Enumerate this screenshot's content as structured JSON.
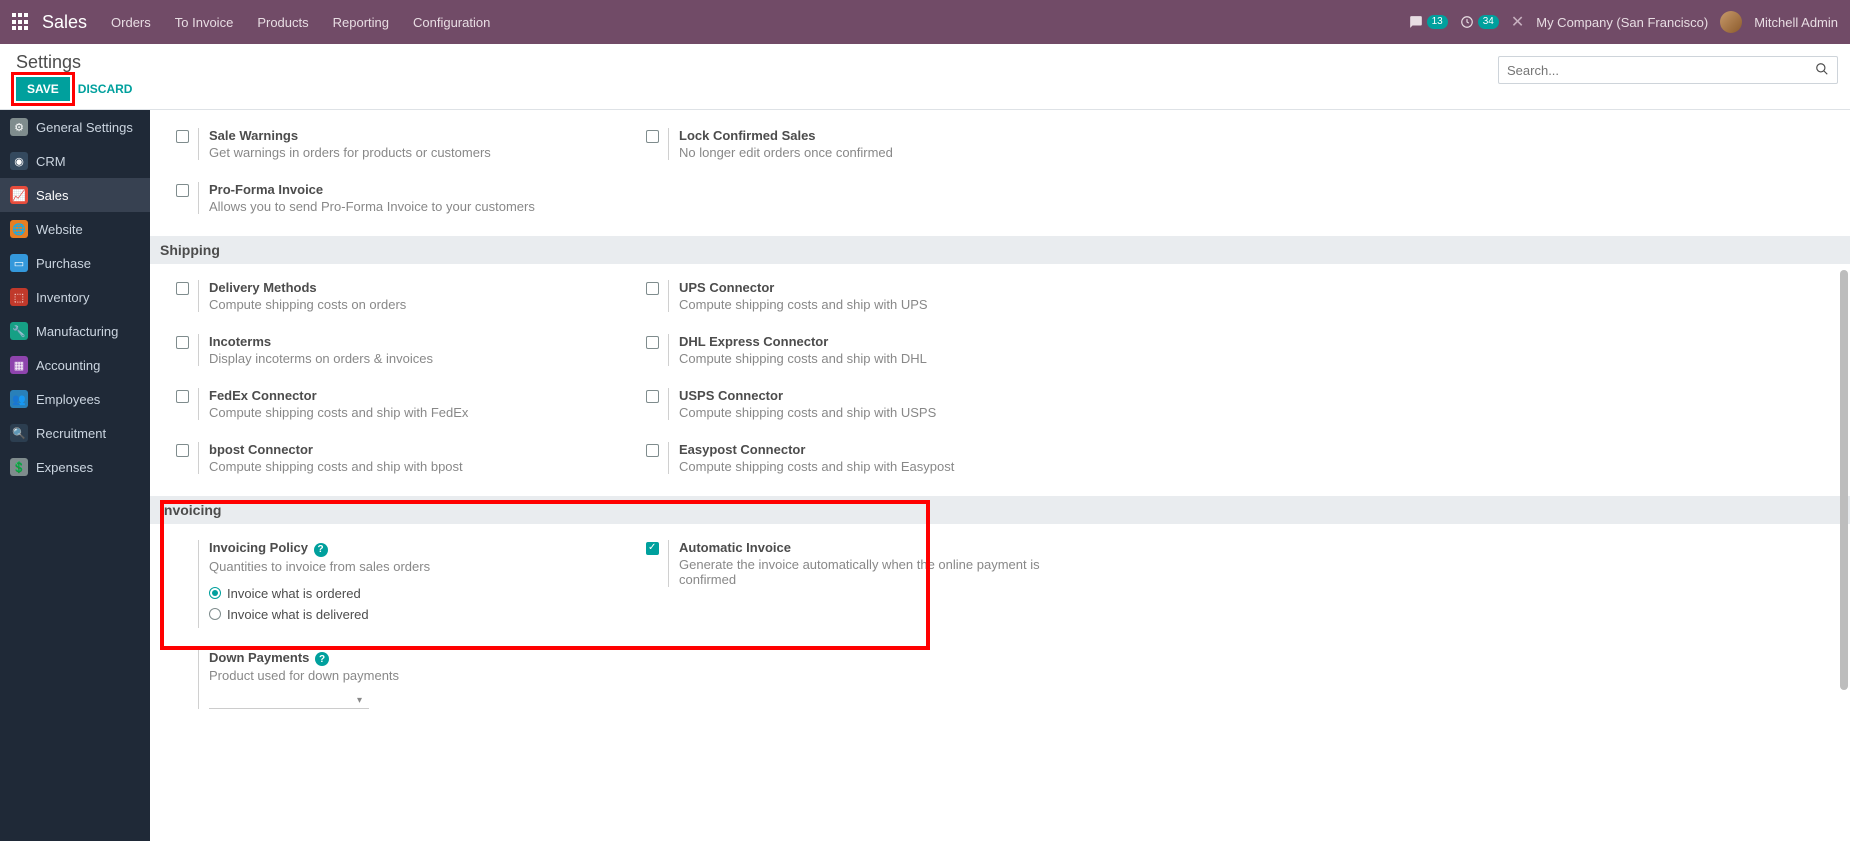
{
  "topbar": {
    "brand": "Sales",
    "menu": [
      "Orders",
      "To Invoice",
      "Products",
      "Reporting",
      "Configuration"
    ],
    "msg_count": "13",
    "activity_count": "34",
    "company": "My Company (San Francisco)",
    "user": "Mitchell Admin"
  },
  "subheader": {
    "title": "Settings",
    "save": "Save",
    "discard": "Discard",
    "search_placeholder": "Search..."
  },
  "sidebar": {
    "items": [
      {
        "label": "General Settings"
      },
      {
        "label": "CRM"
      },
      {
        "label": "Sales"
      },
      {
        "label": "Website"
      },
      {
        "label": "Purchase"
      },
      {
        "label": "Inventory"
      },
      {
        "label": "Manufacturing"
      },
      {
        "label": "Accounting"
      },
      {
        "label": "Employees"
      },
      {
        "label": "Recruitment"
      },
      {
        "label": "Expenses"
      }
    ]
  },
  "sections": {
    "quotes": [
      {
        "title": "Sale Warnings",
        "desc": "Get warnings in orders for products or customers",
        "checked": false
      },
      {
        "title": "Lock Confirmed Sales",
        "desc": "No longer edit orders once confirmed",
        "checked": false
      },
      {
        "title": "Pro-Forma Invoice",
        "desc": "Allows you to send Pro-Forma Invoice to your customers",
        "checked": false
      }
    ],
    "shipping_header": "Shipping",
    "shipping": [
      {
        "title": "Delivery Methods",
        "desc": "Compute shipping costs on orders",
        "checked": false
      },
      {
        "title": "UPS Connector",
        "desc": "Compute shipping costs and ship with UPS",
        "checked": false
      },
      {
        "title": "Incoterms",
        "desc": "Display incoterms on orders & invoices",
        "checked": false
      },
      {
        "title": "DHL Express Connector",
        "desc": "Compute shipping costs and ship with DHL",
        "checked": false
      },
      {
        "title": "FedEx Connector",
        "desc": "Compute shipping costs and ship with FedEx",
        "checked": false
      },
      {
        "title": "USPS Connector",
        "desc": "Compute shipping costs and ship with USPS",
        "checked": false
      },
      {
        "title": "bpost Connector",
        "desc": "Compute shipping costs and ship with bpost",
        "checked": false
      },
      {
        "title": "Easypost Connector",
        "desc": "Compute shipping costs and ship with Easypost",
        "checked": false
      }
    ],
    "invoicing_header": "Invoicing",
    "invoicing": {
      "policy": {
        "title": "Invoicing Policy",
        "desc": "Quantities to invoice from sales orders",
        "opt1": "Invoice what is ordered",
        "opt2": "Invoice what is delivered"
      },
      "auto": {
        "title": "Automatic Invoice",
        "desc": "Generate the invoice automatically when the online payment is confirmed",
        "checked": true
      },
      "down": {
        "title": "Down Payments",
        "desc": "Product used for down payments"
      }
    }
  }
}
